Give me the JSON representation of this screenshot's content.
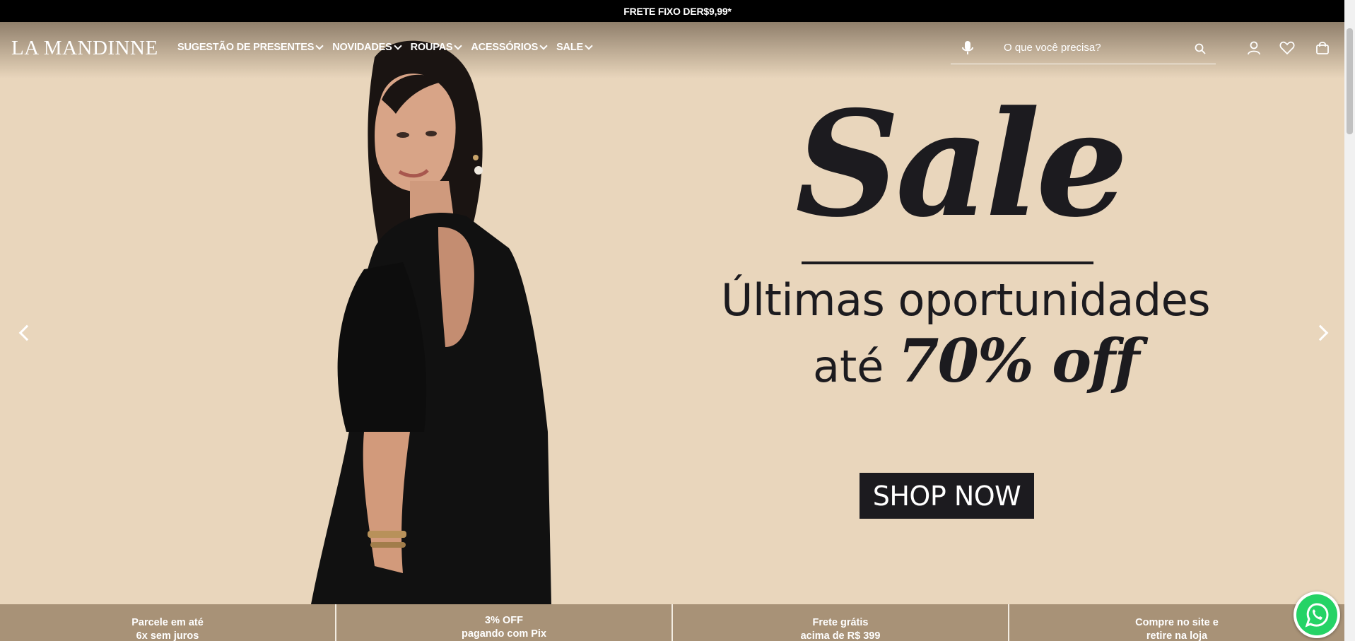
{
  "topbar": {
    "text_prefix": "FRETE FIXO DE ",
    "text_price": "R$9,99*"
  },
  "header": {
    "logo": "LA MANDINNE",
    "nav": [
      {
        "label": "SUGESTÃO DE PRESENTES"
      },
      {
        "label": "NOVIDADES"
      },
      {
        "label": "ROUPAS"
      },
      {
        "label": "ACESSÓRIOS"
      },
      {
        "label": "SALE"
      }
    ],
    "search": {
      "placeholder": "O que você precisa?"
    },
    "icons": [
      "microphone-icon",
      "search-icon",
      "user-icon",
      "heart-icon",
      "bag-icon"
    ]
  },
  "hero": {
    "headline": "Sale",
    "subline1": "Últimas oportunidades",
    "subline2_prefix": "até ",
    "subline2_highlight": "70% off",
    "cta": "SHOP NOW",
    "background": "#e9d6bc",
    "text_color": "#1c1b1f"
  },
  "benefits": [
    {
      "line1": "Parcele em até",
      "line2": "6x sem juros"
    },
    {
      "line1": "3% OFF",
      "line2": "pagando com Pix"
    },
    {
      "line1": "Frete grátis",
      "line2": "acima de R$ 399"
    },
    {
      "line1": "Compre no site e",
      "line2": "retire na loja"
    }
  ],
  "colors": {
    "benefits_bg": "#a89277",
    "topbar_bg": "#000000",
    "whatsapp": "#25d366"
  }
}
